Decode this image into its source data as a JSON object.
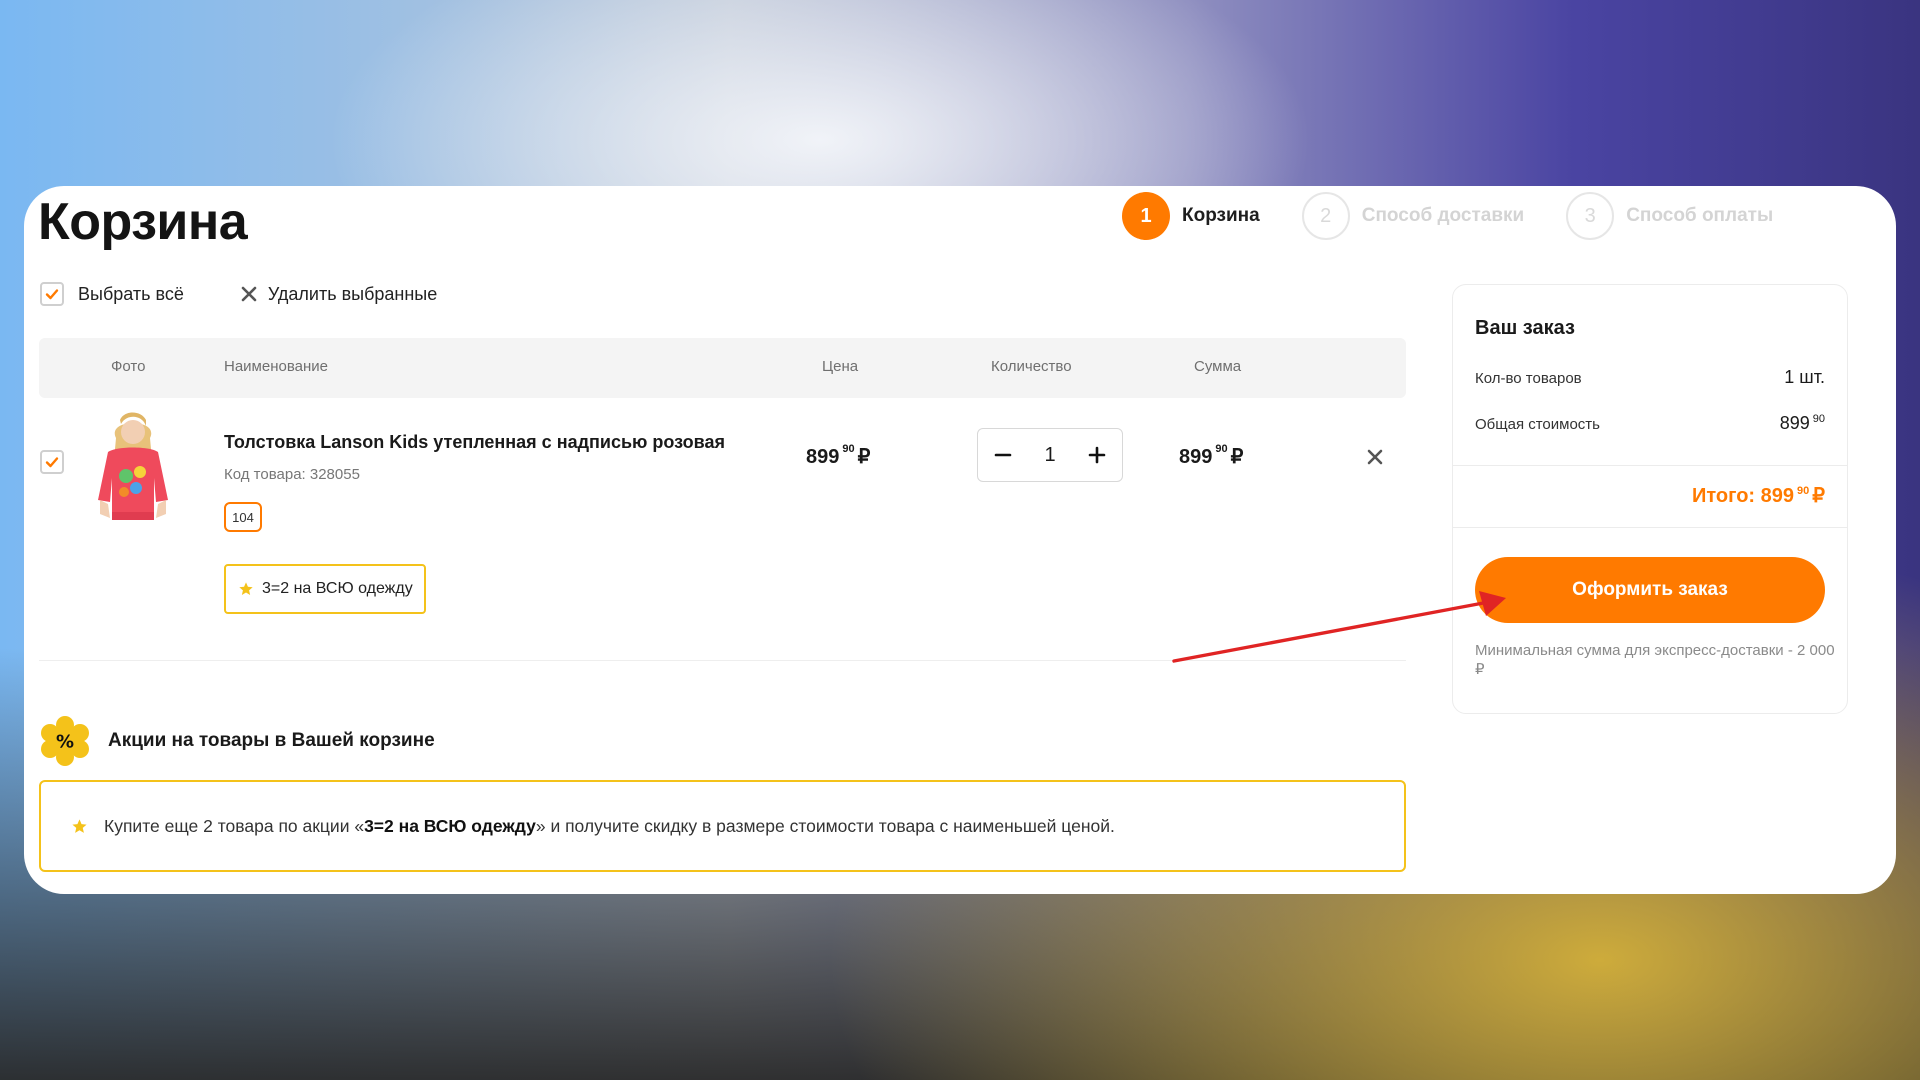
{
  "page": {
    "title": "Корзина"
  },
  "steps": [
    {
      "number": "1",
      "label": "Корзина",
      "state": "active"
    },
    {
      "number": "2",
      "label": "Способ доставки",
      "state": "inactive"
    },
    {
      "number": "3",
      "label": "Способ оплаты",
      "state": "inactive"
    }
  ],
  "actions": {
    "select_all": "Выбрать всё",
    "delete_selected": "Удалить выбранные"
  },
  "table": {
    "headers": {
      "photo": "Фото",
      "name": "Наименование",
      "price": "Цена",
      "quantity": "Количество",
      "sum": "Сумма"
    }
  },
  "item": {
    "name": "Толстовка Lanson Kids утепленная с надписью розовая",
    "code": "Код товара: 328055",
    "size": "104",
    "promo": "3=2 на ВСЮ одежду",
    "price": {
      "rub": "899",
      "kop": "90",
      "currency": "₽"
    },
    "quantity": "1",
    "sum": {
      "rub": "899",
      "kop": "90",
      "currency": "₽"
    }
  },
  "promotions": {
    "title": "Акции на товары в Вашей корзине",
    "text_before": "Купите еще 2 товара по акции «",
    "text_bold": "3=2 на ВСЮ одежду",
    "text_after": "» и получите скидку в размере стоимости товара с наименьшей ценой."
  },
  "summary": {
    "title": "Ваш заказ",
    "count_label": "Кол-во товаров",
    "count_value": "1 шт.",
    "cost_label": "Общая стоимость",
    "cost_rub": "899",
    "cost_kop": "90",
    "total_label": "Итого: 899",
    "total_kop": "90",
    "total_currency": "₽",
    "checkout": "Оформить заказ",
    "express_note": "Минимальная сумма для экспресс-доставки - 2 000 ₽"
  },
  "colors": {
    "accent": "#ff7a00",
    "promo_border": "#f4c21a",
    "arrow": "#e02424"
  }
}
